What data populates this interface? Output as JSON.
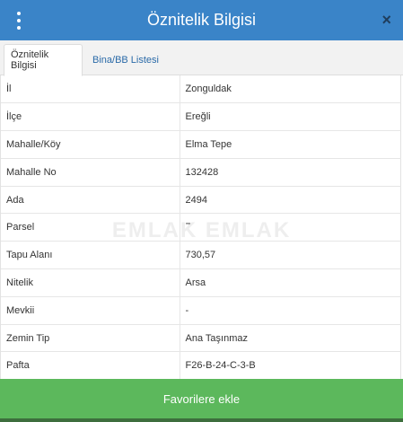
{
  "header": {
    "title": "Öznitelik Bilgisi",
    "menu_icon": "vertical-dots-icon",
    "close_icon": "close-icon",
    "close_glyph": "×"
  },
  "tabs": [
    {
      "label": "Öznitelik Bilgisi",
      "active": true
    },
    {
      "label": "Bina/BB Listesi",
      "active": false
    }
  ],
  "rows": [
    {
      "key": "İl",
      "value": "Zonguldak"
    },
    {
      "key": "İlçe",
      "value": "Ereğli"
    },
    {
      "key": "Mahalle/Köy",
      "value": "Elma Tepe"
    },
    {
      "key": "Mahalle No",
      "value": "132428"
    },
    {
      "key": "Ada",
      "value": "2494"
    },
    {
      "key": "Parsel",
      "value": "7"
    },
    {
      "key": "Tapu Alanı",
      "value": "730,57"
    },
    {
      "key": "Nitelik",
      "value": "Arsa"
    },
    {
      "key": "Mevkii",
      "value": "-"
    },
    {
      "key": "Zemin Tip",
      "value": "Ana Taşınmaz"
    },
    {
      "key": "Pafta",
      "value": "F26-B-24-C-3-B"
    }
  ],
  "watermark": "EMLAK EMLAK",
  "footer": {
    "button_label": "Favorilere ekle"
  },
  "colors": {
    "header": "#3a84c8",
    "button": "#5cb85c",
    "link": "#2a6aa8"
  }
}
